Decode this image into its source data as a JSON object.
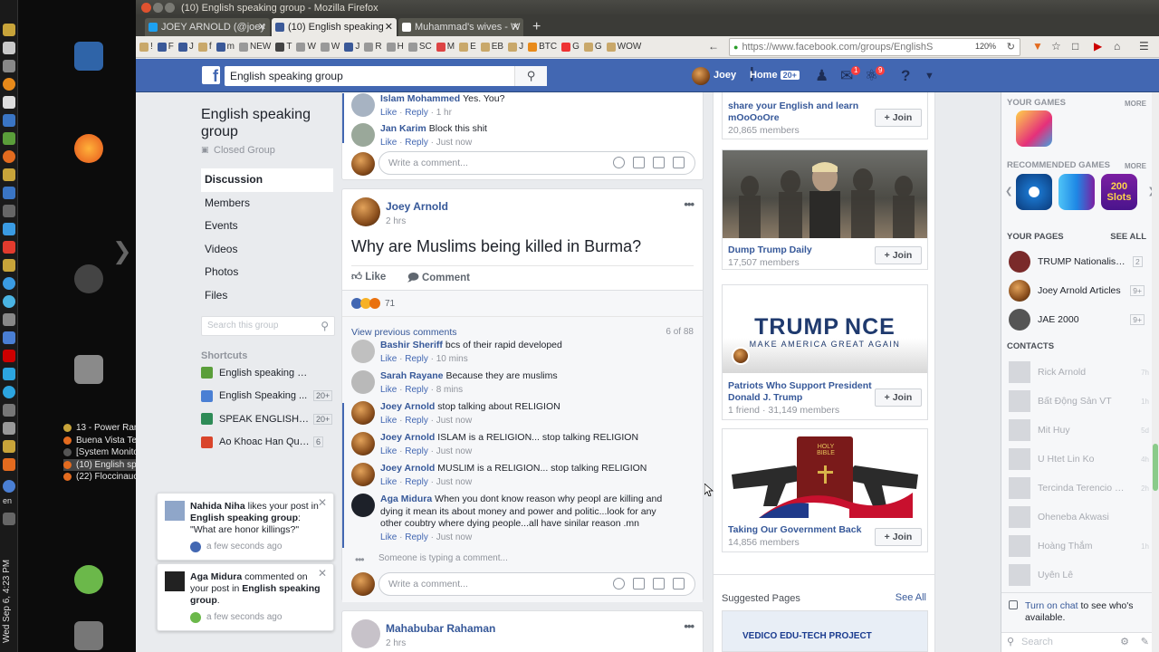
{
  "window": {
    "title": "(10) English speaking group - Mozilla Firefox",
    "tabs": [
      {
        "label": "JOEY ARNOLD (@joey"
      },
      {
        "label": "(10) English speaking"
      },
      {
        "label": "Muhammad's wives - W"
      }
    ],
    "url": "https://www.facebook.com/groups/EnglishS",
    "zoom": "120%",
    "bookmarks": [
      "!",
      "F",
      "J",
      "f",
      "m",
      "NEW",
      "T",
      "W",
      "W",
      "J",
      "R",
      "H",
      "SC",
      "M",
      "E",
      "EB",
      "J",
      "BTC",
      "G",
      "G",
      "WOW"
    ]
  },
  "desktop": {
    "tasks": [
      {
        "label": "13 - Power Ran..."
      },
      {
        "label": "Buena Vista Te..."
      },
      {
        "label": "[System Monitor]"
      },
      {
        "label": "(10) English sp..."
      },
      {
        "label": "(22) Floccinauc..."
      }
    ],
    "clock": "Wed Sep 6, 4:23 PM",
    "lang": "en"
  },
  "fb": {
    "logo": "f",
    "search_value": "English speaking group",
    "user": "Joey",
    "home": "Home",
    "home_badge": "20+",
    "msg_badge": "1",
    "notif_badge": "9"
  },
  "group": {
    "name": "English speaking group",
    "type": "Closed Group",
    "menu": [
      "Discussion",
      "Members",
      "Events",
      "Videos",
      "Photos",
      "Files"
    ],
    "search_placeholder": "Search this group",
    "shortcuts_title": "Shortcuts",
    "shortcuts": [
      {
        "label": "English speaking group",
        "badge": "",
        "color": "#5a9e3a"
      },
      {
        "label": "English Speaking ...",
        "badge": "20+",
        "color": "#4a7fd4"
      },
      {
        "label": "SPEAK ENGLISH F...",
        "badge": "20+",
        "color": "#2e8b57"
      },
      {
        "label": "Ao Khoac Han Quoc ...",
        "badge": "6",
        "color": "#d9452b"
      }
    ]
  },
  "toasts": [
    {
      "name": "Nahida Niha",
      "mid": "likes your post in",
      "group": "English speaking group",
      "text": ": \"What are honor killings?\"",
      "time": "a few seconds ago"
    },
    {
      "name": "Aga Midura",
      "mid": "commented on your post in",
      "group": "English speaking group",
      "text": ".",
      "time": "a few seconds ago"
    }
  ],
  "feed": {
    "top_comments": [
      {
        "name": "Islam Mohammed",
        "text": "Yes. You?",
        "time": "1 hr"
      },
      {
        "name": "Jan Karim",
        "text": "Block this shit",
        "time": "Just now"
      }
    ],
    "write_comment": "Write a comment...",
    "like": "Like",
    "reply": "Reply",
    "post": {
      "author": "Joey Arnold",
      "time": "2 hrs",
      "text": "Why are Muslims being killed in Burma?",
      "like_btn": "Like",
      "comment_btn": "Comment",
      "reactions_count": "71",
      "view_previous": "View previous comments",
      "comment_count": "6 of 88",
      "comments": [
        {
          "name": "Bashir Sheriff",
          "text": "bcs of their rapid developed",
          "time": "10 mins"
        },
        {
          "name": "Sarah Rayane",
          "text": "Because they are muslims",
          "time": "8 mins"
        },
        {
          "name": "Joey Arnold",
          "text": "stop talking about RELIGION",
          "time": "Just now"
        },
        {
          "name": "Joey Arnold",
          "text": "ISLAM is a RELIGION... stop talking RELIGION",
          "time": "Just now"
        },
        {
          "name": "Joey Arnold",
          "text": "MUSLIM is a RELIGION... stop talking RELIGION",
          "time": "Just now"
        },
        {
          "name": "Aga Midura",
          "text": "When you dont know reason why peopl are killing and dying it mean its about money and power and politic...look for any other coubtry where dying people...all have sinilar reason .mn",
          "time": "Just now"
        }
      ],
      "typing": "Someone is typing a comment..."
    },
    "next_post": {
      "author": "Mahabubar Rahaman",
      "time": "2 hrs"
    }
  },
  "suggested": {
    "groups": [
      {
        "title": "share your English and learn mOoOoOre",
        "members": "20,865 members"
      },
      {
        "title": "Dump Trump Daily",
        "members": "17,507 members"
      },
      {
        "title": "Patriots Who Support President Donald J. Trump",
        "members": "1 friend · 31,149 members"
      },
      {
        "title": "Taking Our Government Back",
        "members": "14,856 members"
      }
    ],
    "join": "+ Join",
    "banner_main": "TRUMP NCE",
    "banner_sub": "MAKE AMERICA GREAT AGAIN",
    "bible_label": "HOLY BIBLE",
    "pages_title": "Suggested Pages",
    "see_all": "See All",
    "page_banner": "VEDICO EDU-TECH PROJECT"
  },
  "chat": {
    "your_games": "YOUR GAMES",
    "recommended_games": "RECOMMENDED GAMES",
    "more": "MORE",
    "game_label": "200 Slots",
    "your_pages": "YOUR PAGES",
    "see_all": "SEE ALL",
    "pages": [
      {
        "label": "TRUMP Nationalism O...",
        "badge": "2"
      },
      {
        "label": "Joey Arnold Articles",
        "badge": "9+"
      },
      {
        "label": "JAE 2000",
        "badge": "9+"
      }
    ],
    "contacts_title": "CONTACTS",
    "contacts": [
      {
        "label": "Rick Arnold",
        "time": "7h"
      },
      {
        "label": "Bất Động Sản VT",
        "time": "1h"
      },
      {
        "label": "Mit Huy",
        "time": "5d"
      },
      {
        "label": "U Htet Lin Ko",
        "time": "4h"
      },
      {
        "label": "Tercinda Terencio M...",
        "time": "2h"
      },
      {
        "label": "Oheneba Akwasi",
        "time": ""
      },
      {
        "label": "Hoàng Thắm",
        "time": "1h"
      },
      {
        "label": "Uyên Lê",
        "time": ""
      }
    ],
    "turn_on_link": "Turn on chat",
    "turn_on_rest": " to see who's available.",
    "search": "Search"
  }
}
